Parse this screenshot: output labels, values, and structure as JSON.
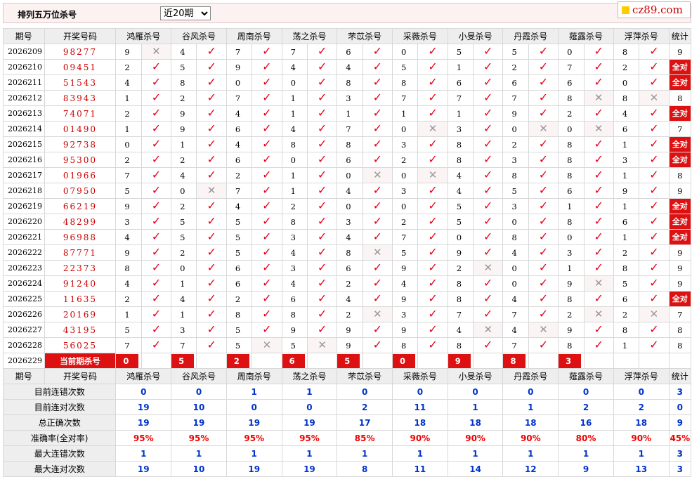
{
  "header": {
    "title": "排列五万位杀号",
    "select_value": "近20期",
    "logo_text": "cz89.com"
  },
  "columns": {
    "period": "期号",
    "draw": "开奖号码",
    "experts": [
      "鸿雁杀号",
      "谷风杀号",
      "周南杀号",
      "荡之杀号",
      "芣苡杀号",
      "采薇杀号",
      "小旻杀号",
      "丹霞杀号",
      "薤露杀号",
      "浮萍杀号"
    ],
    "stat": "统计"
  },
  "rows": [
    {
      "p": "2026209",
      "n": "98277",
      "e": [
        [
          "9",
          0
        ],
        [
          "4",
          1
        ],
        [
          "7",
          1
        ],
        [
          "7",
          1
        ],
        [
          "6",
          1
        ],
        [
          "0",
          1
        ],
        [
          "5",
          1
        ],
        [
          "5",
          1
        ],
        [
          "0",
          1
        ],
        [
          "8",
          1
        ]
      ],
      "s": "9"
    },
    {
      "p": "2026210",
      "n": "09451",
      "e": [
        [
          "2",
          1
        ],
        [
          "5",
          1
        ],
        [
          "9",
          1
        ],
        [
          "4",
          1
        ],
        [
          "4",
          1
        ],
        [
          "5",
          1
        ],
        [
          "1",
          1
        ],
        [
          "2",
          1
        ],
        [
          "7",
          1
        ],
        [
          "2",
          1
        ]
      ],
      "s": "全对"
    },
    {
      "p": "2026211",
      "n": "51543",
      "e": [
        [
          "4",
          1
        ],
        [
          "8",
          1
        ],
        [
          "0",
          1
        ],
        [
          "0",
          1
        ],
        [
          "8",
          1
        ],
        [
          "8",
          1
        ],
        [
          "6",
          1
        ],
        [
          "6",
          1
        ],
        [
          "6",
          1
        ],
        [
          "0",
          1
        ]
      ],
      "s": "全对"
    },
    {
      "p": "2026212",
      "n": "83943",
      "e": [
        [
          "1",
          1
        ],
        [
          "2",
          1
        ],
        [
          "7",
          1
        ],
        [
          "1",
          1
        ],
        [
          "3",
          1
        ],
        [
          "7",
          1
        ],
        [
          "7",
          1
        ],
        [
          "7",
          1
        ],
        [
          "8",
          0
        ],
        [
          "8",
          0
        ]
      ],
      "s": "8"
    },
    {
      "p": "2026213",
      "n": "74071",
      "e": [
        [
          "2",
          1
        ],
        [
          "9",
          1
        ],
        [
          "4",
          1
        ],
        [
          "1",
          1
        ],
        [
          "1",
          1
        ],
        [
          "1",
          1
        ],
        [
          "1",
          1
        ],
        [
          "9",
          1
        ],
        [
          "2",
          1
        ],
        [
          "4",
          1
        ]
      ],
      "s": "全对"
    },
    {
      "p": "2026214",
      "n": "01490",
      "e": [
        [
          "1",
          1
        ],
        [
          "9",
          1
        ],
        [
          "6",
          1
        ],
        [
          "4",
          1
        ],
        [
          "7",
          1
        ],
        [
          "0",
          0
        ],
        [
          "3",
          1
        ],
        [
          "0",
          0
        ],
        [
          "0",
          0
        ],
        [
          "6",
          1
        ]
      ],
      "s": "7"
    },
    {
      "p": "2026215",
      "n": "92738",
      "e": [
        [
          "0",
          1
        ],
        [
          "1",
          1
        ],
        [
          "4",
          1
        ],
        [
          "8",
          1
        ],
        [
          "8",
          1
        ],
        [
          "3",
          1
        ],
        [
          "8",
          1
        ],
        [
          "2",
          1
        ],
        [
          "8",
          1
        ],
        [
          "1",
          1
        ]
      ],
      "s": "全对"
    },
    {
      "p": "2026216",
      "n": "95300",
      "e": [
        [
          "2",
          1
        ],
        [
          "2",
          1
        ],
        [
          "6",
          1
        ],
        [
          "0",
          1
        ],
        [
          "6",
          1
        ],
        [
          "2",
          1
        ],
        [
          "8",
          1
        ],
        [
          "3",
          1
        ],
        [
          "8",
          1
        ],
        [
          "3",
          1
        ]
      ],
      "s": "全对"
    },
    {
      "p": "2026217",
      "n": "01966",
      "e": [
        [
          "7",
          1
        ],
        [
          "4",
          1
        ],
        [
          "2",
          1
        ],
        [
          "1",
          1
        ],
        [
          "0",
          0
        ],
        [
          "0",
          0
        ],
        [
          "4",
          1
        ],
        [
          "8",
          1
        ],
        [
          "8",
          1
        ],
        [
          "1",
          1
        ]
      ],
      "s": "8"
    },
    {
      "p": "2026218",
      "n": "07950",
      "e": [
        [
          "5",
          1
        ],
        [
          "0",
          0
        ],
        [
          "7",
          1
        ],
        [
          "1",
          1
        ],
        [
          "4",
          1
        ],
        [
          "3",
          1
        ],
        [
          "4",
          1
        ],
        [
          "5",
          1
        ],
        [
          "6",
          1
        ],
        [
          "9",
          1
        ]
      ],
      "s": "9"
    },
    {
      "p": "2026219",
      "n": "66219",
      "e": [
        [
          "9",
          1
        ],
        [
          "2",
          1
        ],
        [
          "4",
          1
        ],
        [
          "2",
          1
        ],
        [
          "0",
          1
        ],
        [
          "0",
          1
        ],
        [
          "5",
          1
        ],
        [
          "3",
          1
        ],
        [
          "1",
          1
        ],
        [
          "1",
          1
        ]
      ],
      "s": "全对"
    },
    {
      "p": "2026220",
      "n": "48299",
      "e": [
        [
          "3",
          1
        ],
        [
          "5",
          1
        ],
        [
          "5",
          1
        ],
        [
          "8",
          1
        ],
        [
          "3",
          1
        ],
        [
          "2",
          1
        ],
        [
          "5",
          1
        ],
        [
          "0",
          1
        ],
        [
          "8",
          1
        ],
        [
          "6",
          1
        ]
      ],
      "s": "全对"
    },
    {
      "p": "2026221",
      "n": "96988",
      "e": [
        [
          "4",
          1
        ],
        [
          "5",
          1
        ],
        [
          "5",
          1
        ],
        [
          "3",
          1
        ],
        [
          "4",
          1
        ],
        [
          "7",
          1
        ],
        [
          "0",
          1
        ],
        [
          "8",
          1
        ],
        [
          "0",
          1
        ],
        [
          "1",
          1
        ]
      ],
      "s": "全对"
    },
    {
      "p": "2026222",
      "n": "87771",
      "e": [
        [
          "9",
          1
        ],
        [
          "2",
          1
        ],
        [
          "5",
          1
        ],
        [
          "4",
          1
        ],
        [
          "8",
          0
        ],
        [
          "5",
          1
        ],
        [
          "9",
          1
        ],
        [
          "4",
          1
        ],
        [
          "3",
          1
        ],
        [
          "2",
          1
        ]
      ],
      "s": "9"
    },
    {
      "p": "2026223",
      "n": "22373",
      "e": [
        [
          "8",
          1
        ],
        [
          "0",
          1
        ],
        [
          "6",
          1
        ],
        [
          "3",
          1
        ],
        [
          "6",
          1
        ],
        [
          "9",
          1
        ],
        [
          "2",
          0
        ],
        [
          "0",
          1
        ],
        [
          "1",
          1
        ],
        [
          "8",
          1
        ]
      ],
      "s": "9"
    },
    {
      "p": "2026224",
      "n": "91240",
      "e": [
        [
          "4",
          1
        ],
        [
          "1",
          1
        ],
        [
          "6",
          1
        ],
        [
          "4",
          1
        ],
        [
          "2",
          1
        ],
        [
          "4",
          1
        ],
        [
          "8",
          1
        ],
        [
          "0",
          1
        ],
        [
          "9",
          0
        ],
        [
          "5",
          1
        ]
      ],
      "s": "9"
    },
    {
      "p": "2026225",
      "n": "11635",
      "e": [
        [
          "2",
          1
        ],
        [
          "4",
          1
        ],
        [
          "2",
          1
        ],
        [
          "6",
          1
        ],
        [
          "4",
          1
        ],
        [
          "9",
          1
        ],
        [
          "8",
          1
        ],
        [
          "4",
          1
        ],
        [
          "8",
          1
        ],
        [
          "6",
          1
        ]
      ],
      "s": "全对"
    },
    {
      "p": "2026226",
      "n": "20169",
      "e": [
        [
          "1",
          1
        ],
        [
          "1",
          1
        ],
        [
          "8",
          1
        ],
        [
          "8",
          1
        ],
        [
          "2",
          0
        ],
        [
          "3",
          1
        ],
        [
          "7",
          1
        ],
        [
          "7",
          1
        ],
        [
          "2",
          0
        ],
        [
          "2",
          0
        ]
      ],
      "s": "7"
    },
    {
      "p": "2026227",
      "n": "43195",
      "e": [
        [
          "5",
          1
        ],
        [
          "3",
          1
        ],
        [
          "5",
          1
        ],
        [
          "9",
          1
        ],
        [
          "9",
          1
        ],
        [
          "9",
          1
        ],
        [
          "4",
          0
        ],
        [
          "4",
          0
        ],
        [
          "9",
          1
        ],
        [
          "8",
          1
        ]
      ],
      "s": "8"
    },
    {
      "p": "2026228",
      "n": "56025",
      "e": [
        [
          "7",
          1
        ],
        [
          "7",
          1
        ],
        [
          "5",
          0
        ],
        [
          "5",
          0
        ],
        [
          "9",
          1
        ],
        [
          "8",
          1
        ],
        [
          "8",
          1
        ],
        [
          "7",
          1
        ],
        [
          "8",
          1
        ],
        [
          "1",
          1
        ]
      ],
      "s": "8"
    }
  ],
  "current": {
    "p": "2026229",
    "label": "当前期杀号",
    "kills": [
      "0",
      "5",
      "2",
      "6",
      "5",
      "0",
      "9",
      "8",
      "3"
    ]
  },
  "stats": [
    {
      "label": "目前连错次数",
      "vals": [
        "0",
        "0",
        "1",
        "1",
        "0",
        "0",
        "0",
        "0",
        "0",
        "0",
        "3"
      ]
    },
    {
      "label": "目前连对次数",
      "vals": [
        "19",
        "10",
        "0",
        "0",
        "2",
        "11",
        "1",
        "1",
        "2",
        "2",
        "0"
      ]
    },
    {
      "label": "总正确次数",
      "vals": [
        "19",
        "19",
        "19",
        "19",
        "17",
        "18",
        "18",
        "18",
        "16",
        "18",
        "9"
      ]
    },
    {
      "label": "准确率(全对率)",
      "vals": [
        "95%",
        "95%",
        "95%",
        "95%",
        "85%",
        "90%",
        "90%",
        "90%",
        "80%",
        "90%",
        "45%"
      ],
      "red": true
    },
    {
      "label": "最大连错次数",
      "vals": [
        "1",
        "1",
        "1",
        "1",
        "1",
        "1",
        "1",
        "1",
        "1",
        "1",
        "3"
      ]
    },
    {
      "label": "最大连对次数",
      "vals": [
        "19",
        "10",
        "19",
        "19",
        "8",
        "11",
        "14",
        "12",
        "9",
        "13",
        "3"
      ]
    }
  ],
  "marks": {
    "check": "✓",
    "cross": "✕"
  },
  "colors": {
    "accent_red": "#d11111",
    "check_red": "#e8001c",
    "stat_blue": "#0033cc",
    "header_bg": "#eeeeee"
  }
}
